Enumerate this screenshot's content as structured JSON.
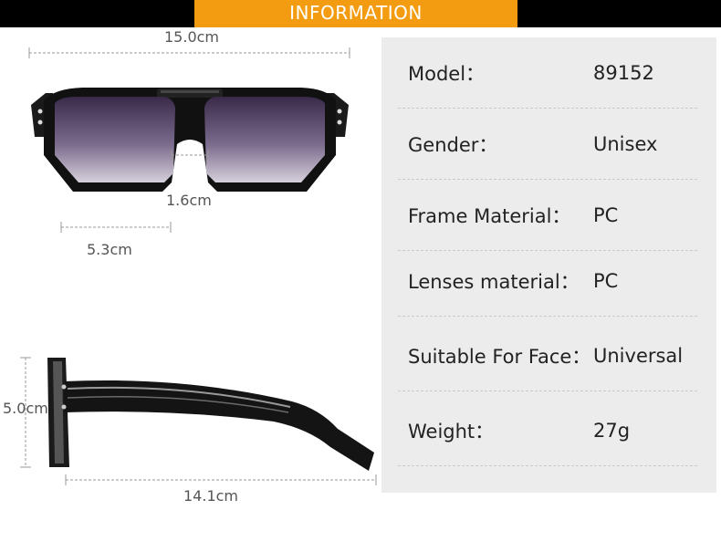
{
  "header": {
    "title": "INFORMATION"
  },
  "dimensions": {
    "total_width": "15.0cm",
    "bridge": "1.6cm",
    "lens_width": "5.3cm",
    "lens_height": "5.0cm",
    "temple_length": "14.1cm"
  },
  "specs": [
    {
      "label": "Model：",
      "value": "89152"
    },
    {
      "label": "Gender：",
      "value": "Unisex"
    },
    {
      "label": "Frame Material：",
      "value": "PC"
    },
    {
      "label": "Lenses material：",
      "value": "PC"
    },
    {
      "label": "Suitable For Face：",
      "value": "Universal"
    },
    {
      "label": "Weight：",
      "value": "27g"
    }
  ],
  "colors": {
    "banner": "#f39c12",
    "topbar": "#000000",
    "panel": "#ececec"
  }
}
